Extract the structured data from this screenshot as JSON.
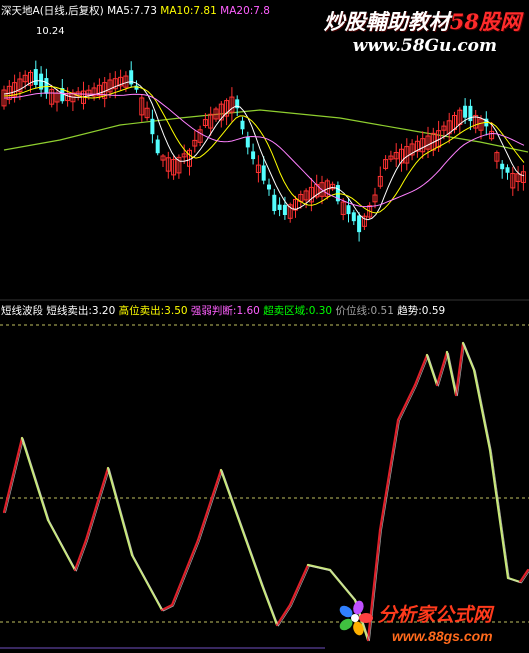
{
  "colors": {
    "background": "#000000",
    "up_candle": "#ff3232",
    "down_candle": "#54ffff",
    "ma5": "#ffffff",
    "ma10": "#ffff00",
    "ma20": "#ff80ff",
    "ma60": "#8fcf2f",
    "hdr_white": "#ffffff",
    "hdr_yellow": "#ffff00",
    "hdr_magenta": "#ff60ff",
    "hdr_green": "#00ff00",
    "hdr_grey": "#a0a0a0",
    "wave_red": "#e0202a",
    "wave_green": "#c8e878",
    "ref_line": "#c0c060",
    "guide_line": "#d0d0d0"
  },
  "top_header": {
    "stock": "深天地A",
    "period": "(日线,后复权)",
    "ma5_label": "MA5:",
    "ma5_value": "7.73",
    "ma10_label": "MA10:",
    "ma10_value": "7.81",
    "ma20_label": "MA20:",
    "ma20_value": "7.8"
  },
  "price_marker": "10.24",
  "watermarks": {
    "site_cn_white": "炒股輔助教材",
    "site_cn_red": "58股网",
    "site_url": "www.58Gu.com",
    "logo_cn": "分析家公式网",
    "logo_url": "www.88gs.com"
  },
  "bottom_header": {
    "indicator": "短线波段",
    "sell_label": "短线卖出:",
    "sell_value": "3.20",
    "high_label": "高位卖出:",
    "high_value": "3.50",
    "judge_label": "强弱判断:",
    "judge_value": "1.60",
    "oversold_label": "超卖区域:",
    "oversold_value": "0.30",
    "price_line_label": "价位线:",
    "price_line_value": "0.51",
    "trend_label": "趋势:",
    "trend_value": "0.59"
  }
}
